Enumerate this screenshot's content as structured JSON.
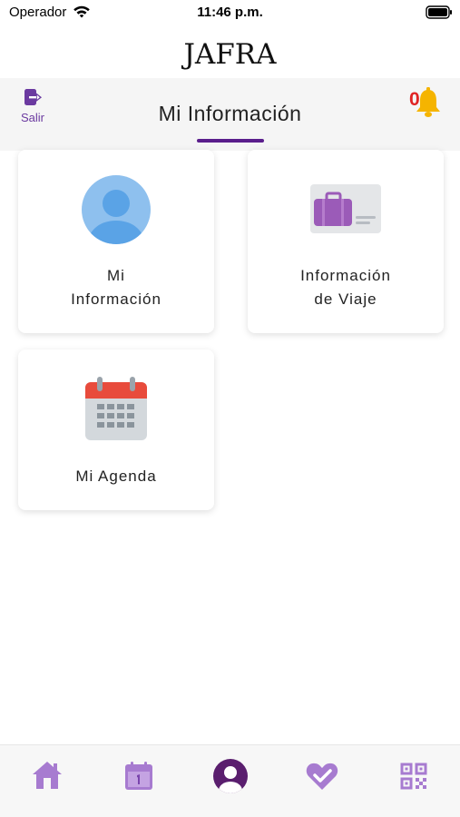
{
  "status_bar": {
    "carrier": "Operador",
    "time": "11:46 p.m."
  },
  "brand": {
    "name": "JAFRA"
  },
  "header": {
    "logout_label": "Salir",
    "title": "Mi Información",
    "notification_count": "0"
  },
  "cards": [
    {
      "label": "Mi\nInformación",
      "icon": "user-avatar-icon"
    },
    {
      "label": "Información\nde Viaje",
      "icon": "luggage-ticket-icon"
    },
    {
      "label": "Mi Agenda",
      "icon": "calendar-icon"
    }
  ],
  "tabs": [
    {
      "icon": "home-icon"
    },
    {
      "icon": "calendar-day-icon"
    },
    {
      "icon": "profile-icon",
      "active": true
    },
    {
      "icon": "heart-check-icon"
    },
    {
      "icon": "qr-code-icon"
    }
  ],
  "colors": {
    "accent": "#6b3aa0",
    "accent_dark": "#5a1e8c",
    "tab_icon": "#a77bd0",
    "bell": "#f5b400",
    "badge": "#e02424"
  }
}
